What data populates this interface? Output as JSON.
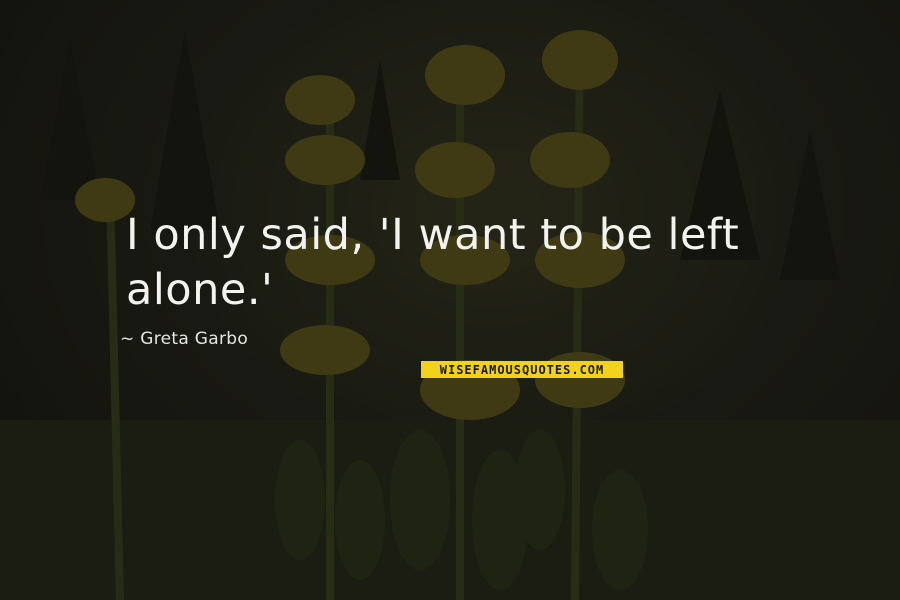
{
  "quote": {
    "text": "I only said, 'I want to be left alone.'"
  },
  "author": {
    "text": "~ Greta Garbo"
  },
  "watermark": {
    "text": "WISEFAMOUSQUOTES.COM"
  },
  "colors": {
    "logo_bg": "#f2d21a",
    "text": "#f2f2ee",
    "background": "#1e1f18"
  },
  "background_image": "dark meadow with yellow gentian flowers"
}
